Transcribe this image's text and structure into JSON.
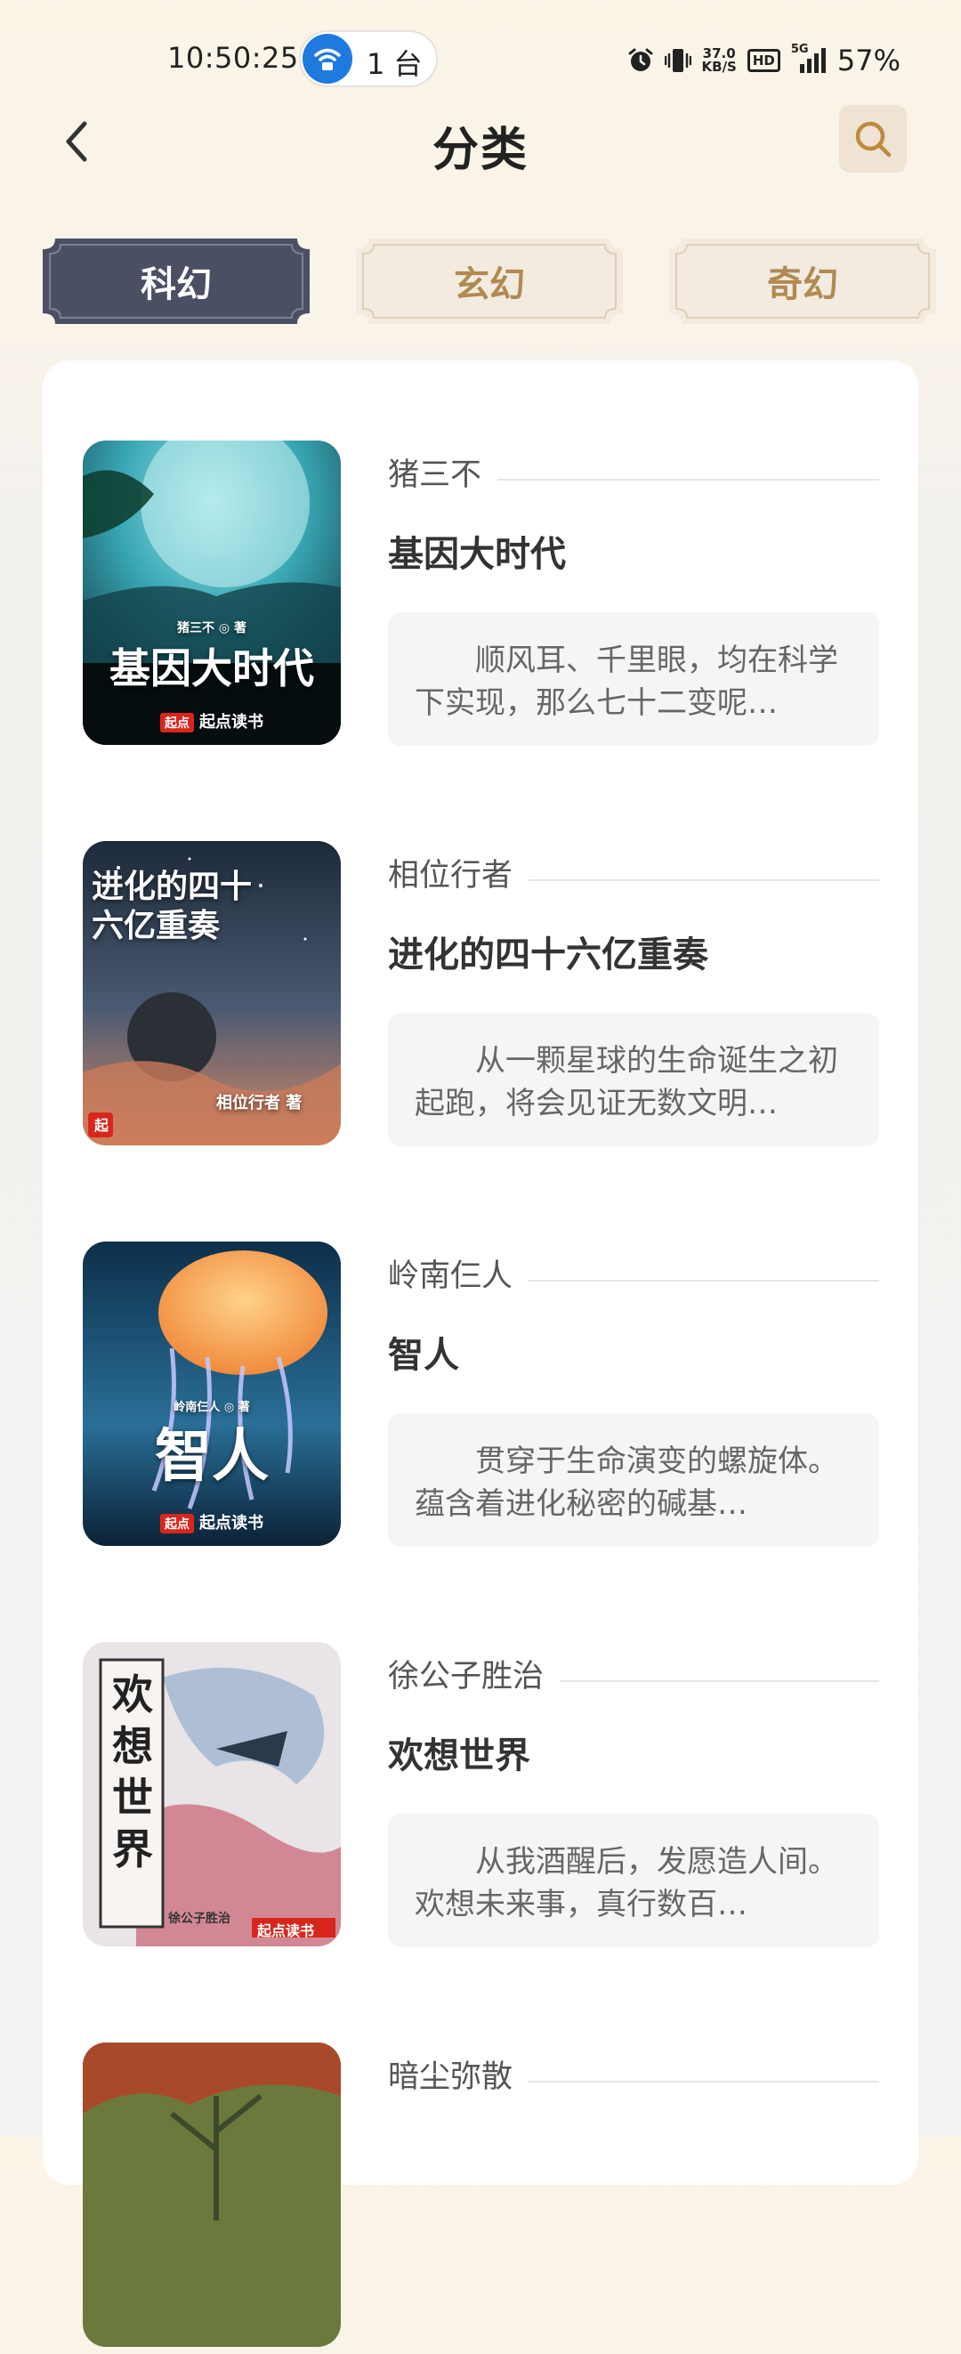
{
  "status_bar": {
    "time": "10:50:25",
    "hotspot_count": "1 台",
    "net_speed_value": "37.0",
    "net_speed_unit": "KB/S",
    "hd_label": "HD",
    "network_label": "5G",
    "battery": "57%"
  },
  "header": {
    "title": "分类"
  },
  "tabs": [
    {
      "label": "科幻",
      "active": true
    },
    {
      "label": "玄幻",
      "active": false
    },
    {
      "label": "奇幻",
      "active": false
    }
  ],
  "books": [
    {
      "author": "猪三不",
      "title": "基因大时代",
      "synopsis": "顺风耳、千里眼，均在科学下实现，那么七十二变呢…",
      "cover_title": "基因大时代",
      "cover_author_line": "猪三不 ◎ 著",
      "cover_brand": "起点读书",
      "cover_colors": [
        "#0b2f3a",
        "#3aa8b5",
        "#9fe3e8"
      ]
    },
    {
      "author": "相位行者",
      "title": "进化的四十六亿重奏",
      "synopsis": "从一颗星球的生命诞生之初起跑，将会见证无数文明…",
      "cover_title": "进化的四十六亿重奏",
      "cover_author_line": "相位行者 著",
      "cover_brand": "起",
      "cover_colors": [
        "#1d2a3a",
        "#4a5a72",
        "#d98a66"
      ]
    },
    {
      "author": "岭南仨人",
      "title": "智人",
      "synopsis": "贯穿于生命演变的螺旋体。蕴含着进化秘密的碱基…",
      "cover_title": "智人",
      "cover_author_line": "岭南仨人 ◎ 著",
      "cover_brand": "起点读书",
      "cover_colors": [
        "#0d2f4a",
        "#2a6f98",
        "#f08a3c"
      ]
    },
    {
      "author": "徐公子胜治",
      "title": "欢想世界",
      "synopsis": "从我酒醒后，发愿造人间。欢想未来事，真行数百…",
      "cover_title": "欢想世界",
      "cover_author_line": "徐公子胜治",
      "cover_brand": "起点读书",
      "cover_colors": [
        "#e9e4e8",
        "#9fb4cf",
        "#c96a78"
      ]
    },
    {
      "author": "暗尘弥散",
      "title": "",
      "synopsis": "",
      "cover_title": "",
      "cover_author_line": "",
      "cover_brand": "",
      "cover_colors": [
        "#6b7a3c",
        "#a84a2a",
        "#3b4a2a"
      ]
    }
  ],
  "icons": {
    "back": "chevron-left-icon",
    "search": "search-icon",
    "hotspot": "wifi-hotspot-icon",
    "alarm": "alarm-icon",
    "vibrate": "vibrate-icon",
    "signal": "signal-icon"
  },
  "colors": {
    "tab_active_bg": "#4a4f63",
    "tab_inactive_bg": "#f3ebe0",
    "tab_inactive_text": "#b08a52",
    "search_bg": "#efe3d4",
    "search_icon": "#c08a3e"
  }
}
